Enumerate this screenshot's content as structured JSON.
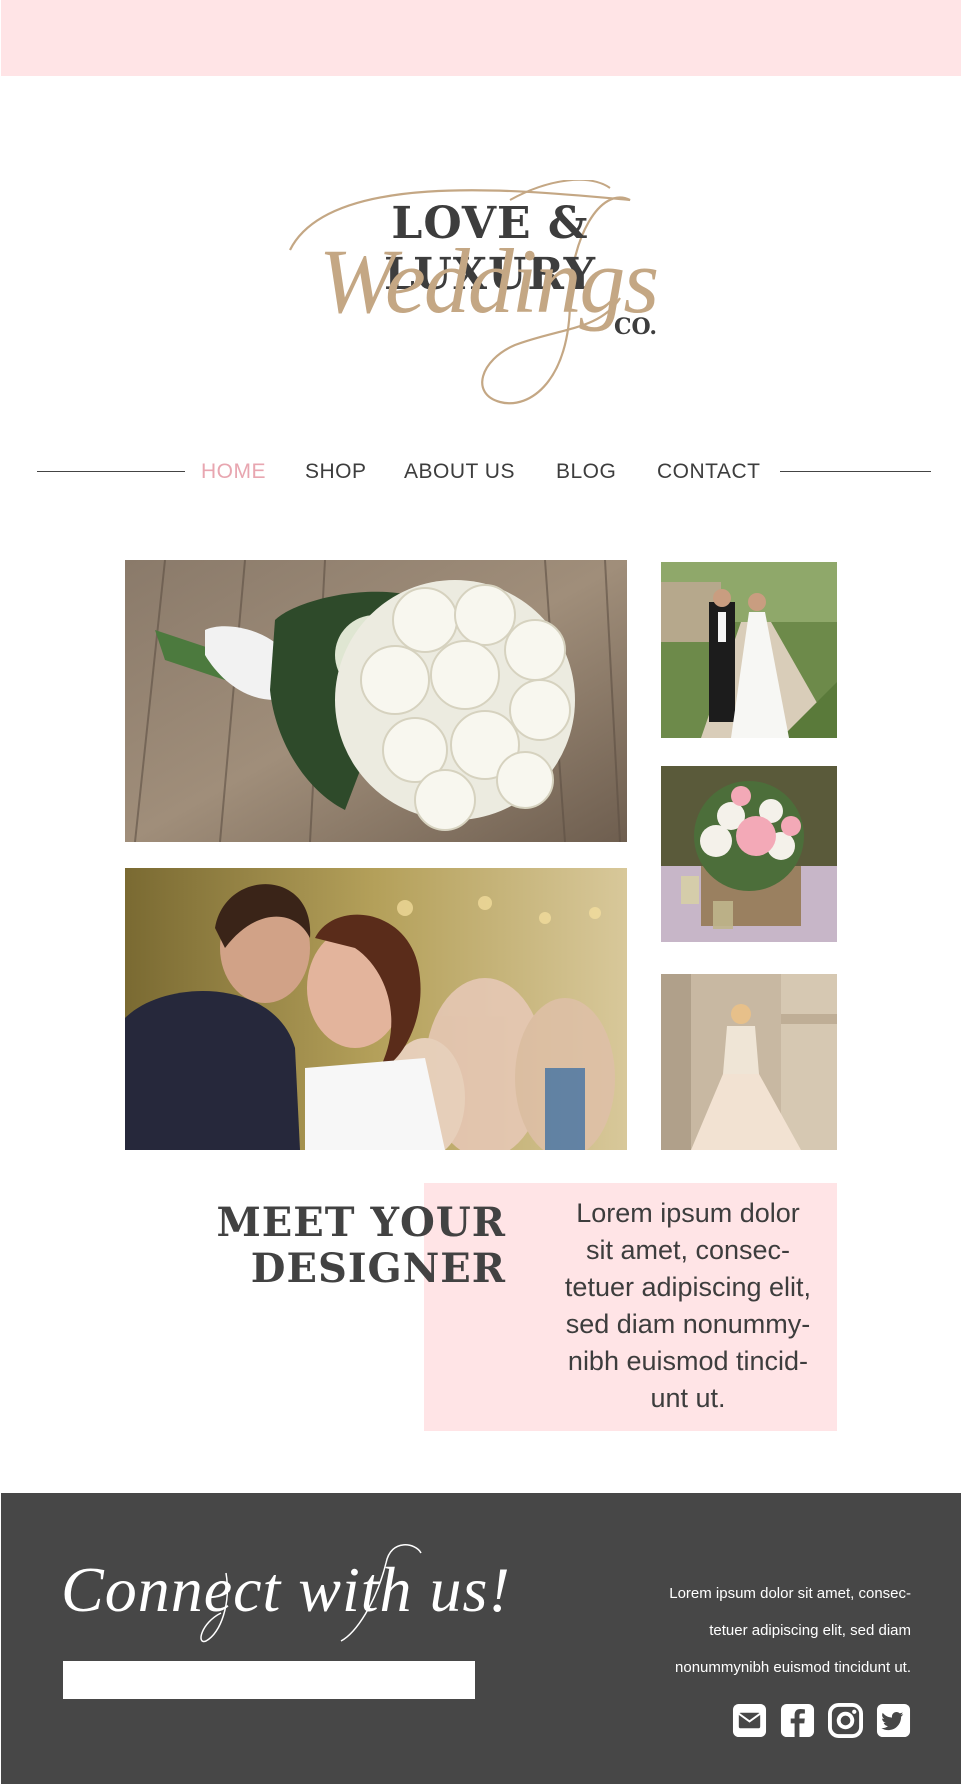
{
  "brand": {
    "line1": "LOVE & LUXURY",
    "line2": "Weddings",
    "line3": "CO.",
    "accent_color": "#c4a784",
    "dark_color": "#3d3d3d",
    "pink_color": "#ffe4e6"
  },
  "nav": {
    "items": [
      {
        "label": "HOME",
        "active": true
      },
      {
        "label": "SHOP"
      },
      {
        "label": "ABOUT US"
      },
      {
        "label": "BLOG"
      },
      {
        "label": "CONTACT"
      }
    ],
    "active_color": "#e8a6b0"
  },
  "gallery": {
    "photos": [
      {
        "name": "bouquet-photo",
        "subject": "white rose bouquet on wooden table"
      },
      {
        "name": "couple-path-photo",
        "subject": "bride and groom on garden path"
      },
      {
        "name": "flowers-photo",
        "subject": "pink rose centerpiece"
      },
      {
        "name": "couple-embrace-photo",
        "subject": "couple embracing at reception"
      },
      {
        "name": "bride-photo",
        "subject": "bride in lace gown"
      }
    ]
  },
  "designer": {
    "title_line1": "MEET YOUR",
    "title_line2": "DESIGNER",
    "text_lines": [
      "Lorem ipsum dolor",
      "sit amet, consec-",
      "tetuer adipiscing elit,",
      "sed diam nonummy-",
      "nibh euismod tincid-",
      "unt ut."
    ]
  },
  "footer": {
    "heading": "Connect with us!",
    "email_value": "",
    "text_lines": [
      "Lorem ipsum dolor sit amet, consec-",
      "tetuer adipiscing elit, sed diam",
      "nonummynibh euismod tincidunt ut."
    ],
    "socials": [
      "envelope-icon",
      "facebook-icon",
      "instagram-icon",
      "twitter-icon"
    ],
    "bg_color": "#474747"
  }
}
